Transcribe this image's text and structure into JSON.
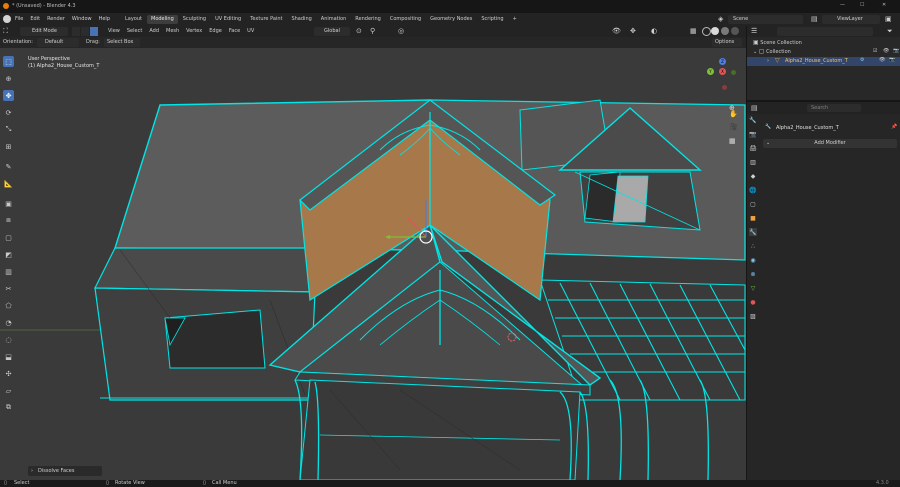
{
  "window": {
    "title": "* (Unsaved) - Blender 4.3"
  },
  "topbar": {
    "menus": [
      "File",
      "Edit",
      "Render",
      "Window",
      "Help"
    ],
    "workspaces": [
      "Layout",
      "Modeling",
      "Sculpting",
      "UV Editing",
      "Texture Paint",
      "Shading",
      "Animation",
      "Rendering",
      "Compositing",
      "Geometry Nodes",
      "Scripting"
    ],
    "active_workspace": "Modeling",
    "add_tab": "+",
    "scene_name": "Scene",
    "viewlayer_name": "ViewLayer"
  },
  "header": {
    "mode": "Edit Mode",
    "menus": [
      "View",
      "Select",
      "Add",
      "Mesh",
      "Vertex",
      "Edge",
      "Face",
      "UV"
    ],
    "transform_orientation": "Global",
    "options_label": "Options",
    "orientation_label": "Orientation:",
    "orientation_value": "Default",
    "drag_label": "Drag:",
    "drag_value": "Select Box"
  },
  "viewport": {
    "perspective": "User Perspective",
    "object_info": "(1) Alpha2_House_Custom_T",
    "last_operator": "Dissolve Faces",
    "gizmo": {
      "x": "X",
      "y": "Y",
      "z": "Z"
    }
  },
  "toolbar": {
    "tools": [
      "select-box",
      "cursor",
      "move",
      "rotate",
      "scale",
      "transform",
      "annotate",
      "measure",
      "add-cube",
      "extrude",
      "inset",
      "bevel",
      "loop-cut",
      "knife",
      "poly-build",
      "spin",
      "smooth",
      "edge-slide",
      "shrink",
      "shear",
      "rip"
    ]
  },
  "outliner": {
    "search_placeholder": "",
    "items": [
      {
        "label": "Scene Collection",
        "level": 0
      },
      {
        "label": "Collection",
        "level": 1
      },
      {
        "label": "Alpha2_House_Custom_T",
        "level": 2,
        "selected": true
      }
    ]
  },
  "properties": {
    "search_placeholder": "Search",
    "object_name": "Alpha2_House_Custom_T",
    "add_modifier_label": "Add Modifier"
  },
  "statusbar": {
    "items": [
      "Select",
      "Rotate View",
      "Call Menu"
    ],
    "version": "4.3.0"
  },
  "colors": {
    "accent": "#4772b3",
    "wire": "#00e5e5",
    "face_selected": "#a7794a",
    "mesh": "#5a5a5a"
  }
}
